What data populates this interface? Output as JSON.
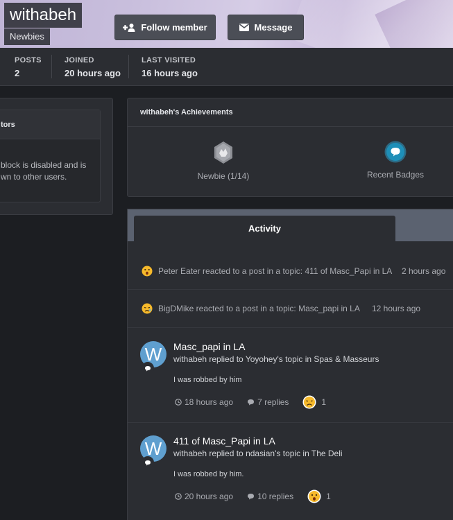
{
  "profile": {
    "name": "withabeh",
    "group": "Newbies",
    "follow_label": "Follow member",
    "message_label": "Message"
  },
  "stats": [
    {
      "label": "POSTS",
      "value": "2"
    },
    {
      "label": "JOINED",
      "value": "20 hours ago"
    },
    {
      "label": "LAST VISITED",
      "value": "16 hours ago"
    }
  ],
  "left_widget": {
    "title": "tors",
    "body_line1": "block is disabled and is",
    "body_line2": "wn to other users."
  },
  "achievements": {
    "title": "withabeh's Achievements",
    "rank_label": "Newbie (1/14)",
    "badges_label": "Recent Badges"
  },
  "activity": {
    "tab_label": "Activity",
    "reactions": [
      {
        "text": "Peter Eater reacted to a post in a topic: 411 of Masc_Papi in LA",
        "time": "2 hours ago"
      },
      {
        "text": "BigDMike reacted to a post in a topic: Masc_papi in LA",
        "time": "12 hours ago"
      }
    ],
    "posts": [
      {
        "avatar_letter": "W",
        "title": "Masc_papi in LA",
        "sub": "withabeh replied to Yoyohey's topic in Spas & Masseurs",
        "snippet": "I was robbed by him",
        "time": "18 hours ago",
        "replies": "7 replies",
        "reaction_count": "1"
      },
      {
        "avatar_letter": "W",
        "title": "411 of Masc_Papi in LA",
        "sub": "withabeh replied to ndasian's topic in The Deli",
        "snippet": "I was robbed by him.",
        "time": "20 hours ago",
        "replies": "10 replies",
        "reaction_count": "1"
      }
    ]
  },
  "colors": {
    "accent_badge": "#1e8fb8",
    "avatar": "#5f9fcf",
    "tabbar": "#5b6270"
  }
}
